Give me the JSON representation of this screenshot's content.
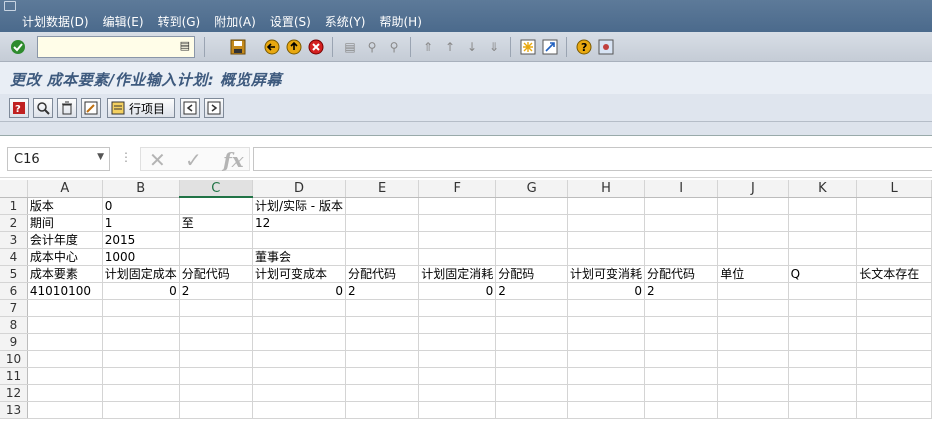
{
  "menu": {
    "items": [
      "计划数据(D)",
      "编辑(E)",
      "转到(G)",
      "附加(A)",
      "设置(S)",
      "系统(Y)",
      "帮助(H)"
    ]
  },
  "screen": {
    "title": "更改 成本要素/作业输入计划: 概览屏幕"
  },
  "app_toolbar": {
    "line_items_label": "行项目"
  },
  "excel": {
    "name_box": "C16",
    "fx_label": "fx",
    "columns": [
      "A",
      "B",
      "C",
      "D",
      "E",
      "F",
      "G",
      "H",
      "I",
      "J",
      "K",
      "L"
    ],
    "row_numbers": [
      "1",
      "2",
      "3",
      "4",
      "5",
      "6",
      "7",
      "8",
      "9",
      "10",
      "11",
      "12",
      "13"
    ],
    "rows": [
      [
        "版本",
        "0",
        "",
        "计划/实际 - 版本",
        "",
        "",
        "",
        "",
        "",
        "",
        "",
        ""
      ],
      [
        "期间",
        "1",
        "至",
        "12",
        "",
        "",
        "",
        "",
        "",
        "",
        "",
        ""
      ],
      [
        "会计年度",
        "2015",
        "",
        "",
        "",
        "",
        "",
        "",
        "",
        "",
        "",
        ""
      ],
      [
        "成本中心",
        "1000",
        "",
        "董事会",
        "",
        "",
        "",
        "",
        "",
        "",
        "",
        ""
      ],
      [
        "成本要素",
        "计划固定成本",
        "分配代码",
        "计划可变成本",
        "分配代码",
        "计划固定消耗",
        "分配码",
        "计划可变消耗",
        "分配代码",
        "单位",
        "Q",
        "长文本存在"
      ],
      [
        "41010100",
        "0",
        "2",
        "0",
        "2",
        "0",
        "2",
        "0",
        "2",
        "",
        "",
        ""
      ],
      [
        "",
        "",
        "",
        "",
        "",
        "",
        "",
        "",
        "",
        "",
        "",
        ""
      ],
      [
        "",
        "",
        "",
        "",
        "",
        "",
        "",
        "",
        "",
        "",
        "",
        ""
      ],
      [
        "",
        "",
        "",
        "",
        "",
        "",
        "",
        "",
        "",
        "",
        "",
        ""
      ],
      [
        "",
        "",
        "",
        "",
        "",
        "",
        "",
        "",
        "",
        "",
        "",
        ""
      ],
      [
        "",
        "",
        "",
        "",
        "",
        "",
        "",
        "",
        "",
        "",
        "",
        ""
      ],
      [
        "",
        "",
        "",
        "",
        "",
        "",
        "",
        "",
        "",
        "",
        "",
        ""
      ],
      [
        "",
        "",
        "",
        "",
        "",
        "",
        "",
        "",
        "",
        "",
        "",
        ""
      ]
    ],
    "selected_column": "C"
  },
  "colors": {
    "menubar": "#4b6a8c",
    "title_text": "#3e5a7e",
    "excel_green": "#217346",
    "highlight_circle": "#e02020"
  }
}
